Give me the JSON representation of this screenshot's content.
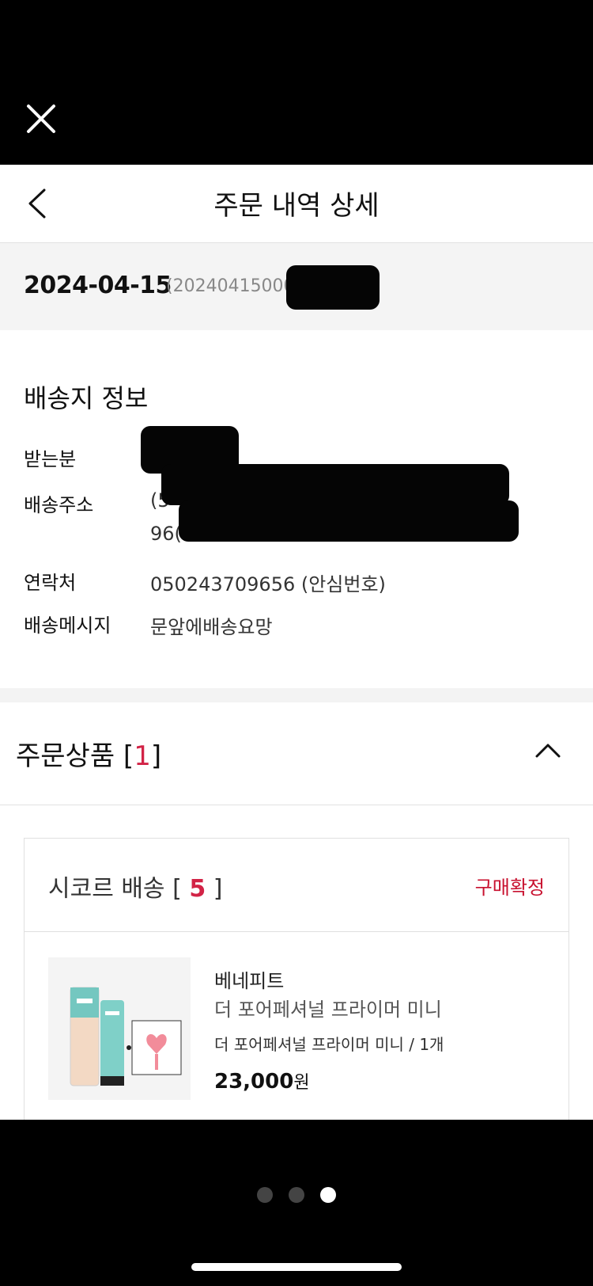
{
  "header": {
    "title": "주문 내역 상세"
  },
  "order": {
    "date": "2024-04-15",
    "number_visible": "(20240415000"
  },
  "shipping": {
    "title": "배송지 정보",
    "rows": [
      {
        "label": "받는분",
        "value": ""
      },
      {
        "label": "배송주소",
        "value_line1": "(5",
        "value_line2": "96("
      },
      {
        "label": "연락처",
        "value": "050243709656 (안심번호)"
      },
      {
        "label": "배송메시지",
        "value": "문앞에배송요망"
      }
    ]
  },
  "products": {
    "title": "주문상품",
    "count": "1"
  },
  "seller": {
    "name": "시코르 배송",
    "count": "5",
    "status": "구매확정",
    "item": {
      "brand": "베네피트",
      "name": "더 포어페셔널 프라이머 미니",
      "option": "더 포어페셔널 프라이머 미니 / 1개",
      "price": "23,000",
      "currency": "원"
    }
  },
  "pager": {
    "total": 3,
    "active": 3
  },
  "icons": {
    "close": "close-icon",
    "back": "chevron-left-icon",
    "collapse": "chevron-up-icon"
  },
  "colors": {
    "accent": "#d22346",
    "status": "#c8102e"
  }
}
